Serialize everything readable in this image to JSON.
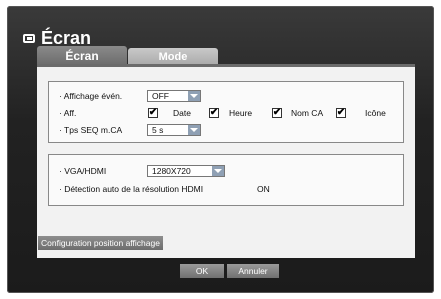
{
  "window": {
    "title": "Écran",
    "title_icon": "screen-icon"
  },
  "tabs": [
    {
      "label": "Écran",
      "active": true
    },
    {
      "label": "Mode",
      "active": false
    }
  ],
  "display_group": {
    "event_display": {
      "label": "· Affichage évén.",
      "value": "OFF"
    },
    "aff": {
      "label": "· Aff.",
      "options": [
        {
          "label": "Date",
          "checked": true
        },
        {
          "label": "Heure",
          "checked": true
        },
        {
          "label": "Nom CA",
          "checked": true
        },
        {
          "label": "Icône",
          "checked": true
        }
      ]
    },
    "seq_time": {
      "label": "· Tps SEQ m.CA",
      "value": "5 s"
    }
  },
  "output_group": {
    "vga_hdmi": {
      "label": "· VGA/HDMI",
      "value": "1280X720"
    },
    "hdmi_auto": {
      "label": "· Détection auto de la résolution HDMI",
      "value": "ON"
    }
  },
  "config_button": "Configuration position affichage",
  "footer": {
    "ok_label": "OK",
    "cancel_label": "Annuler"
  },
  "colors": {
    "dialog_bg": "#222222",
    "panel_bg": "#f2f2f2",
    "dropdown_arrow": "#8fa0b4"
  }
}
